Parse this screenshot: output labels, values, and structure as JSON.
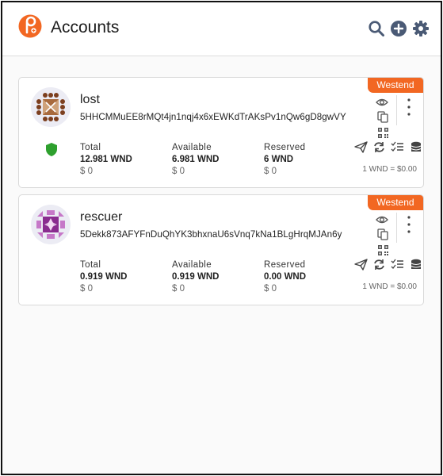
{
  "app": {
    "title": "Accounts"
  },
  "header": {
    "icons": [
      "search-icon",
      "add-account-icon",
      "settings-icon"
    ]
  },
  "colors": {
    "brand": "#f26722",
    "accent": "#4a5a75",
    "shield": "#2ea02e"
  },
  "accounts": [
    {
      "name": "lost",
      "address": "5HHCMMuEE8rMQt4jn1nqj4x6xEWKdTrAKsPv1nQw6gD8gwVY",
      "chain": "Westend",
      "total_label": "Total",
      "total": "12.981 WND",
      "total_fiat": "$ 0",
      "available_label": "Available",
      "available": "6.981 WND",
      "available_fiat": "$ 0",
      "reserved_label": "Reserved",
      "reserved": "6 WND",
      "reserved_fiat": "$ 0",
      "rate": "1 WND = $0.00",
      "avatar": "identicon-brown"
    },
    {
      "name": "rescuer",
      "address": "5Dekk873AFYFnDuQhYK3bhxnaU6sVnq7kNa1BLgHrqMJAn6y",
      "chain": "Westend",
      "total_label": "Total",
      "total": "0.919 WND",
      "total_fiat": "$ 0",
      "available_label": "Available",
      "available": "0.919 WND",
      "available_fiat": "$ 0",
      "reserved_label": "Reserved",
      "reserved": "0.00 WND",
      "reserved_fiat": "$ 0",
      "rate": "1 WND = $0.00",
      "avatar": "identicon-purple"
    }
  ]
}
